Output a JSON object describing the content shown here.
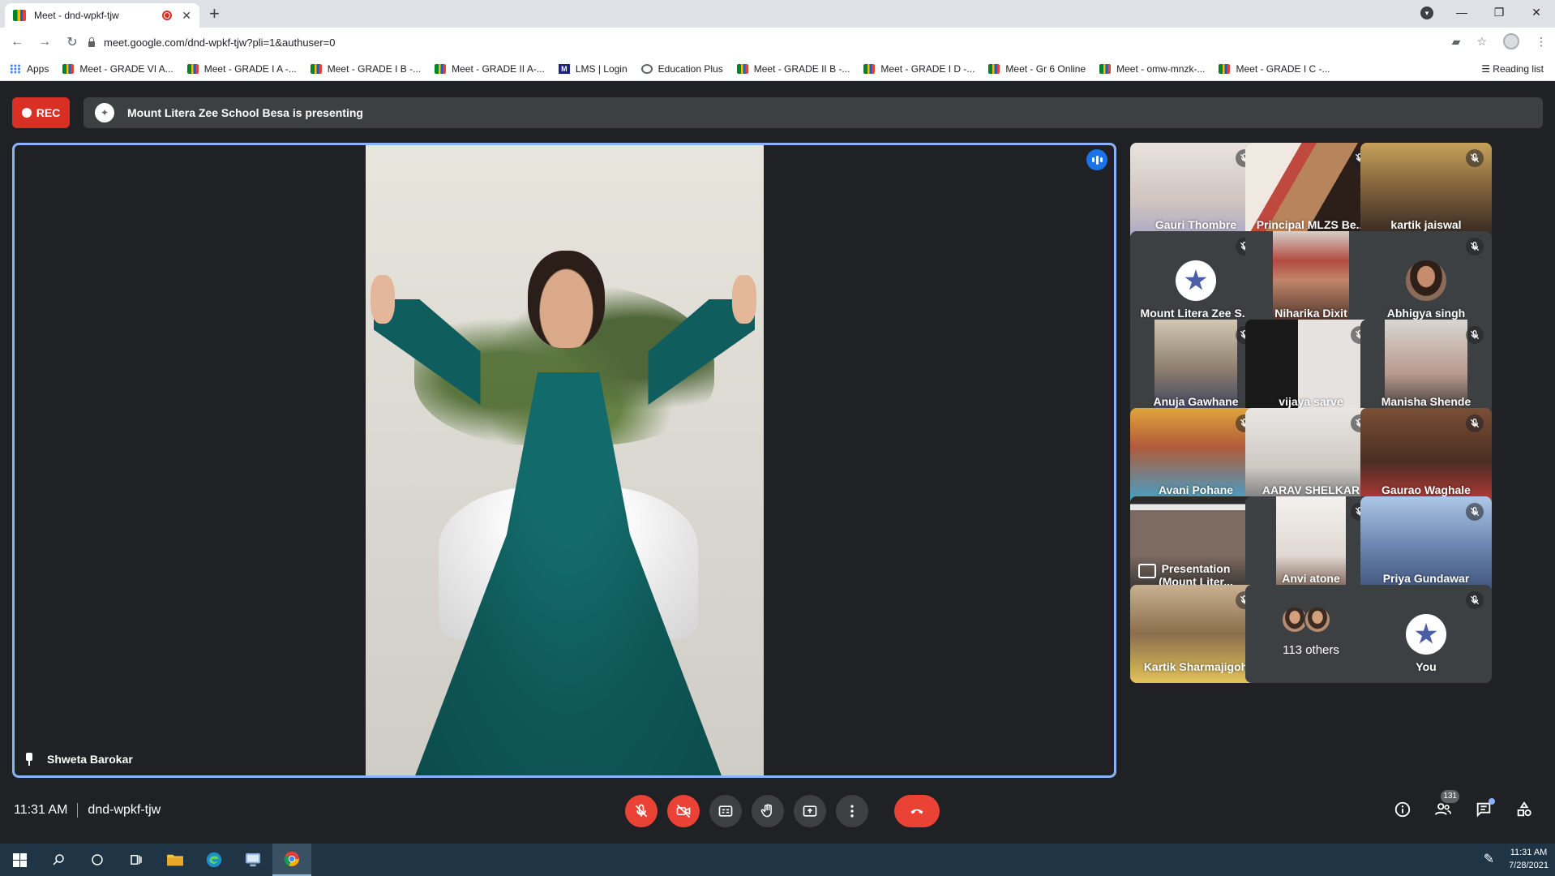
{
  "browser": {
    "tab_title": "Meet - dnd-wpkf-tjw",
    "url": "meet.google.com/dnd-wpkf-tjw?pli=1&authuser=0",
    "bookmarks": [
      {
        "label": "Apps",
        "icon": "apps-grid-icon"
      },
      {
        "label": "Meet - GRADE VI A...",
        "icon": "meet-icon"
      },
      {
        "label": "Meet - GRADE I A -...",
        "icon": "meet-icon"
      },
      {
        "label": "Meet - GRADE I B -...",
        "icon": "meet-icon"
      },
      {
        "label": "Meet - GRADE II A-...",
        "icon": "meet-icon"
      },
      {
        "label": "LMS | Login",
        "icon": "lms-icon"
      },
      {
        "label": "Education Plus",
        "icon": "globe-icon"
      },
      {
        "label": "Meet - GRADE II B -...",
        "icon": "meet-icon"
      },
      {
        "label": "Meet - GRADE I D -...",
        "icon": "meet-icon"
      },
      {
        "label": "Meet - Gr 6 Online",
        "icon": "meet-icon"
      },
      {
        "label": "Meet - omw-mnzk-...",
        "icon": "meet-icon"
      },
      {
        "label": "Meet - GRADE I C -...",
        "icon": "meet-icon"
      }
    ],
    "reading_list": "Reading list"
  },
  "meet": {
    "rec_label": "REC",
    "presenting_banner": "Mount Litera Zee School Besa is presenting",
    "pinned_name": "Shweta Barokar",
    "meeting_time": "11:31 AM",
    "meeting_code": "dnd-wpkf-tjw",
    "participant_count": "131",
    "colors": {
      "accent": "#1a73e8",
      "danger": "#ea4335",
      "background": "#202124",
      "tile": "#3c4043",
      "pin_border": "#8ab4f8"
    }
  },
  "participants": [
    {
      "name": "Gauri Thombre",
      "muted": true
    },
    {
      "name": "Principal MLZS Be...",
      "muted": true
    },
    {
      "name": "kartik jaiswal",
      "muted": true
    },
    {
      "name": "Mount Litera Zee S...",
      "muted": true
    },
    {
      "name": "Niharika Dixit",
      "muted": false
    },
    {
      "name": "Abhigya singh",
      "muted": true
    },
    {
      "name": "Anuja Gawhane",
      "muted": true
    },
    {
      "name": "vijaya sarve",
      "muted": true
    },
    {
      "name": "Manisha Shende",
      "muted": true
    },
    {
      "name": "Avani Pohane",
      "muted": true
    },
    {
      "name": "AARAV SHELKAR",
      "muted": true
    },
    {
      "name": "Gaurao Waghale",
      "muted": true
    },
    {
      "name": "Presentation",
      "name2": "(Mount Liter...",
      "muted": false
    },
    {
      "name": "Anvi atone",
      "muted": true
    },
    {
      "name": "Priya Gundawar",
      "muted": true
    },
    {
      "name": "Kartik Sharmajigoh",
      "muted": true
    },
    {
      "others_label": "113 others"
    },
    {
      "name": "You",
      "muted": true
    }
  ],
  "taskbar": {
    "time": "11:31 AM",
    "date": "7/28/2021"
  }
}
